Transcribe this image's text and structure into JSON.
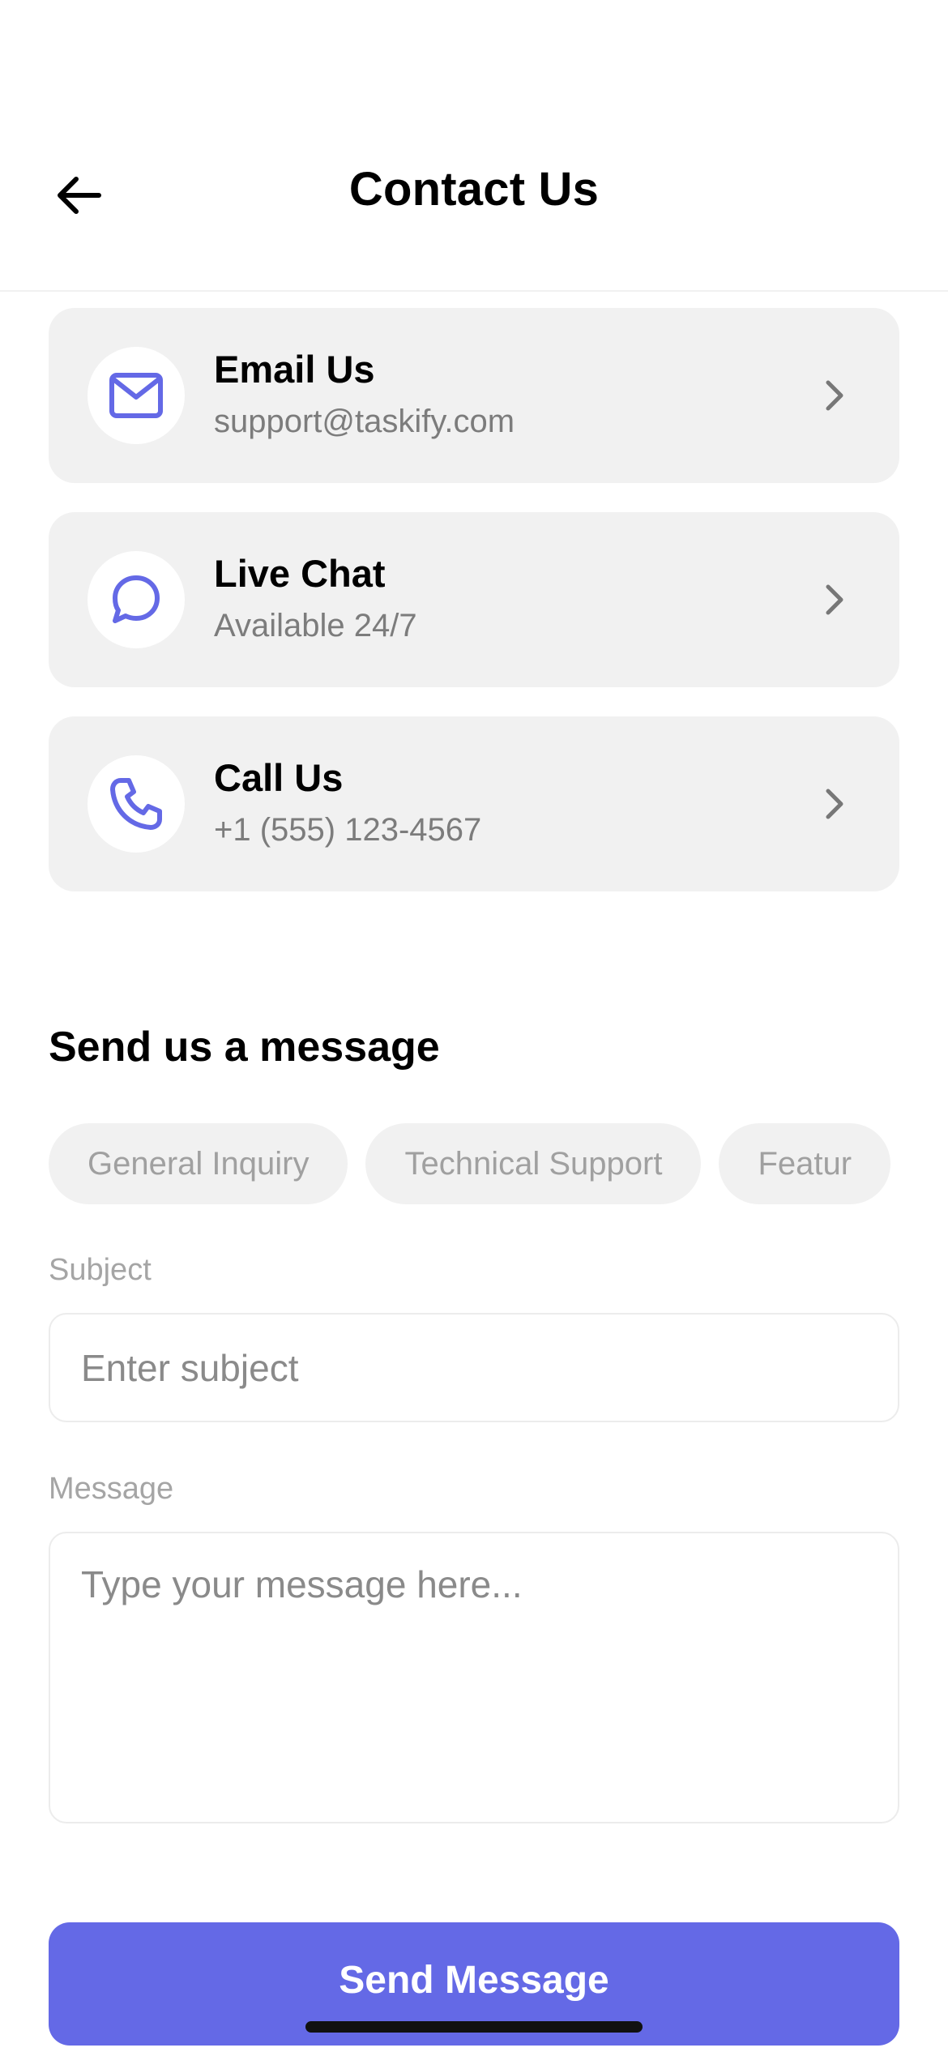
{
  "header": {
    "title": "Contact Us",
    "back_icon": "arrow-left-icon"
  },
  "contact_options": [
    {
      "title": "Email Us",
      "subtitle": "support@taskify.com",
      "icon": "mail-icon"
    },
    {
      "title": "Live Chat",
      "subtitle": "Available 24/7",
      "icon": "chat-bubble-icon"
    },
    {
      "title": "Call Us",
      "subtitle": "+1 (555) 123-4567",
      "icon": "phone-icon"
    }
  ],
  "message_section": {
    "title": "Send us a message",
    "categories": [
      "General Inquiry",
      "Technical Support",
      "Featur"
    ],
    "subject_label": "Subject",
    "subject_placeholder": "Enter subject",
    "message_label": "Message",
    "message_placeholder": "Type your message here...",
    "send_label": "Send Message"
  },
  "colors": {
    "accent": "#6469e6",
    "card_bg": "#f1f1f1",
    "muted_text": "#7c7c7c",
    "chip_text": "#a0a0a0"
  }
}
